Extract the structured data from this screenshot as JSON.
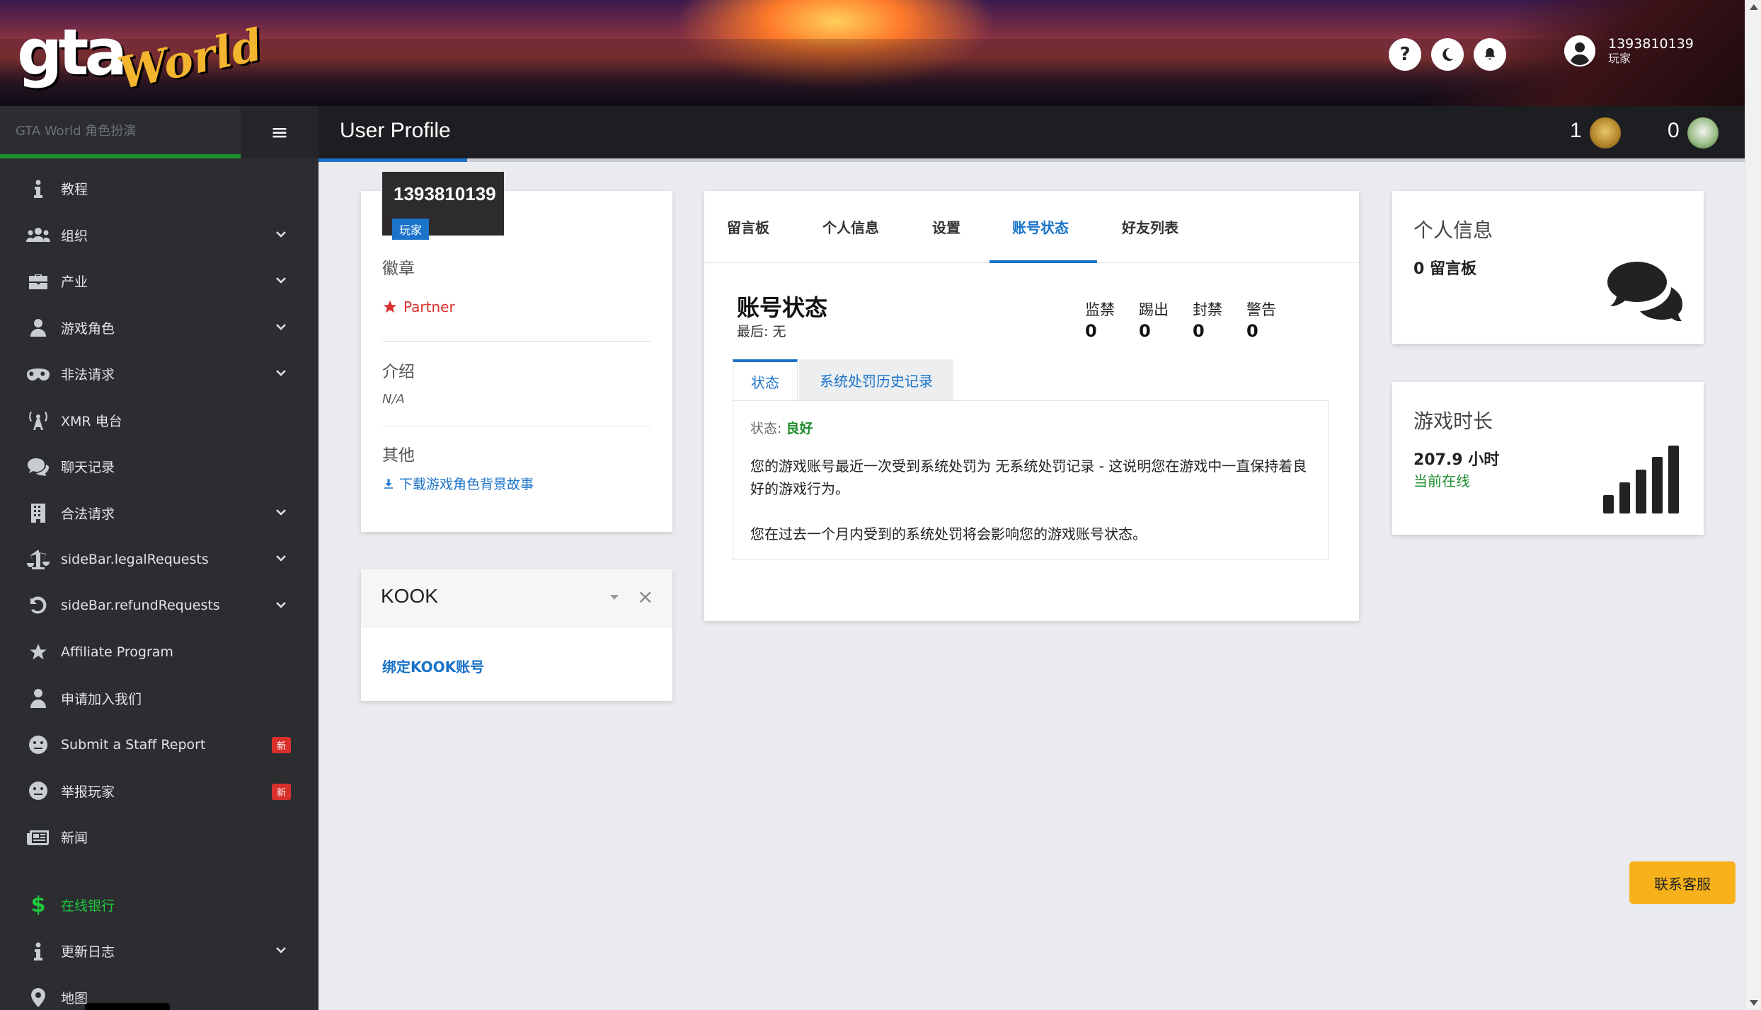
{
  "header": {
    "logo_text_a": "gta",
    "logo_text_b": "World",
    "help_label": "?",
    "user_name": "1393810139",
    "user_role": "玩家"
  },
  "sidebar": {
    "brand": "GTA World 角色扮演",
    "toggle": "≡",
    "items": [
      {
        "label": "教程",
        "icon": "info-icon",
        "has_sub": false
      },
      {
        "label": "组织",
        "icon": "users-icon",
        "has_sub": true
      },
      {
        "label": "产业",
        "icon": "briefcase-icon",
        "has_sub": true
      },
      {
        "label": "游戏角色",
        "icon": "user-icon",
        "has_sub": true
      },
      {
        "label": "非法请求",
        "icon": "mask-icon",
        "has_sub": true
      },
      {
        "label": "XMR 电台",
        "icon": "radio-tower-icon",
        "has_sub": false
      },
      {
        "label": "聊天记录",
        "icon": "chat-icon",
        "has_sub": false
      },
      {
        "label": "合法请求",
        "icon": "building-icon",
        "has_sub": true
      },
      {
        "label": "sideBar.legalRequests",
        "icon": "scale-icon",
        "has_sub": true
      },
      {
        "label": "sideBar.refundRequests",
        "icon": "undo-icon",
        "has_sub": true
      },
      {
        "label": "Affiliate Program",
        "icon": "star-icon",
        "has_sub": false
      },
      {
        "label": "申请加入我们",
        "icon": "staff-icon",
        "has_sub": false
      },
      {
        "label": "Submit a Staff Report",
        "icon": "face-icon",
        "badge": "新"
      },
      {
        "label": "举报玩家",
        "icon": "face-icon",
        "badge": "新"
      },
      {
        "label": "新闻",
        "icon": "newspaper-icon",
        "has_sub": false
      }
    ],
    "bank": {
      "label": "在线银行",
      "icon_glyph": "$"
    },
    "changelog": {
      "label": "更新日志",
      "icon": "info-icon"
    },
    "map": {
      "label": "地图",
      "icon": "map-pin-icon"
    }
  },
  "titlebar": {
    "title": "User Profile",
    "medal_count_1": "1",
    "medal_count_2": "0"
  },
  "profile": {
    "id": "1393810139",
    "role": "玩家",
    "badges_title": "徽章",
    "badge_partner": "Partner",
    "intro_title": "介绍",
    "intro_value": "N/A",
    "other_title": "其他",
    "download_link": "下载游戏角色背景故事"
  },
  "kook": {
    "title": "KOOK",
    "close": "×",
    "bind_link": "绑定KOOK账号"
  },
  "main": {
    "tabs": [
      "留言板",
      "个人信息",
      "设置",
      "账号状态",
      "好友列表"
    ],
    "active_tab": "账号状态",
    "account_title": "账号状态",
    "last": "最后: 无",
    "stats": [
      {
        "label": "监禁",
        "value": "0"
      },
      {
        "label": "踢出",
        "value": "0"
      },
      {
        "label": "封禁",
        "value": "0"
      },
      {
        "label": "警告",
        "value": "0"
      }
    ],
    "subtabs": [
      "状态",
      "系统处罚历史记录"
    ],
    "status_label": "状态: ",
    "status_value": "良好",
    "para1": "您的游戏账号最近一次受到系统处罚为 无系统处罚记录 - 这说明您在游戏中一直保持着良好的游戏行为。",
    "para2": "您在过去一个月内受到的系统处罚将会影响您的游戏账号状态。"
  },
  "info_card": {
    "title": "个人信息",
    "value": "0 留言板"
  },
  "time_card": {
    "title": "游戏时长",
    "value": "207.9 小时",
    "sub": "当前在线"
  },
  "support_button": "联系客服",
  "colors": {
    "accent_blue": "#1a73c9",
    "sidebar_bg": "#2b2d31",
    "green": "#1e8e2e",
    "badge_red": "#d9302c",
    "support_yellow": "#f7b11a"
  }
}
